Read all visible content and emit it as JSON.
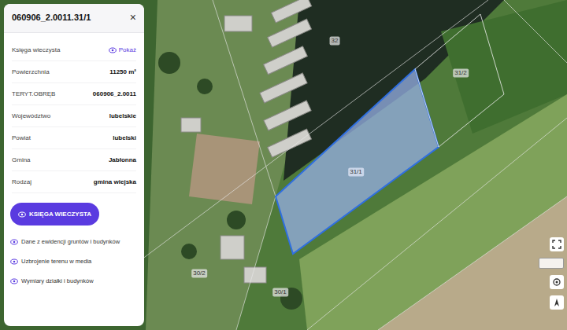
{
  "panel": {
    "title": "060906_2.0011.31/1",
    "close": "×",
    "rows": [
      {
        "label": "Księga wieczysta",
        "value": "Pokaż",
        "kind": "link"
      },
      {
        "label": "Powierzchnia",
        "value": "11250 m²",
        "kind": "text"
      },
      {
        "label": "TERYT.OBRĘB",
        "value": "060906_2.0011",
        "kind": "text"
      },
      {
        "label": "Województwo",
        "value": "lubelskie",
        "kind": "text"
      },
      {
        "label": "Powiat",
        "value": "lubelski",
        "kind": "text"
      },
      {
        "label": "Gmina",
        "value": "Jabłonna",
        "kind": "text"
      },
      {
        "label": "Rodzaj",
        "value": "gmina wiejska",
        "kind": "text"
      }
    ],
    "button": "KSIĘGA WIECZYSTA",
    "links": [
      "Dane z ewidencji gruntów i budynków",
      "Uzbrojenie terenu w media",
      "Wymiary działki i budynków"
    ]
  },
  "map": {
    "parcels": [
      {
        "label": "31/1",
        "selected": true
      },
      {
        "label": "31/2",
        "selected": false
      },
      {
        "label": "32",
        "selected": false
      },
      {
        "label": "30/2",
        "selected": false
      },
      {
        "label": "30/1",
        "selected": false
      }
    ]
  }
}
